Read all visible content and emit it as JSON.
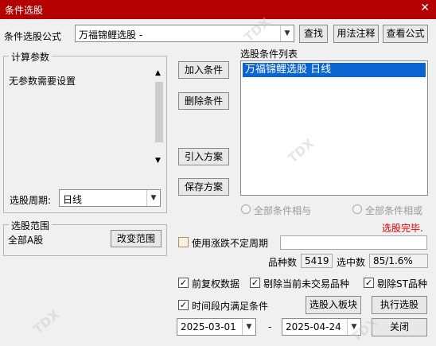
{
  "window": {
    "title": "条件选股",
    "close_glyph": "✕"
  },
  "formula": {
    "label": "条件选股公式",
    "selected": "万福锦鲤选股  -",
    "find_button": "查找",
    "usage_button": "用法注释",
    "view_button": "查看公式"
  },
  "params": {
    "legend": "计算参数",
    "message": "无参数需要设置",
    "period_label": "选股周期:",
    "period_value": "日线"
  },
  "actions": {
    "add_condition": "加入条件",
    "delete_condition": "删除条件",
    "import_plan": "引入方案",
    "save_plan": "保存方案"
  },
  "conditions": {
    "legend": "选股条件列表",
    "items": [
      "万福锦鲤选股  日线"
    ],
    "all_and": "全部条件相与",
    "all_or": "全部条件相或"
  },
  "status_text": "选股完毕.",
  "scope": {
    "legend": "选股范围",
    "value": "全部A股",
    "change_button": "改变范围"
  },
  "variable_period": {
    "label": "使用涨跌不定周期",
    "checked": false
  },
  "stats": {
    "count_label": "品种数",
    "count_value": "5419",
    "selected_label": "选中数",
    "selected_value": "85/1.6%"
  },
  "options": {
    "adjusted": "前复权数据",
    "exclude_untraded": "剔除当前未交易品种",
    "exclude_st": "剔除ST品种",
    "date_range": "时间段内满足条件"
  },
  "date_range": {
    "start": "2025-03-01",
    "separator": "-",
    "end": "2025-04-24"
  },
  "bottom_buttons": {
    "to_block": "选股入板块",
    "execute": "执行选股",
    "close": "关闭"
  },
  "colors": {
    "title_bar": "#b40000",
    "status": "#e00000",
    "selection": "#0a64d2"
  }
}
